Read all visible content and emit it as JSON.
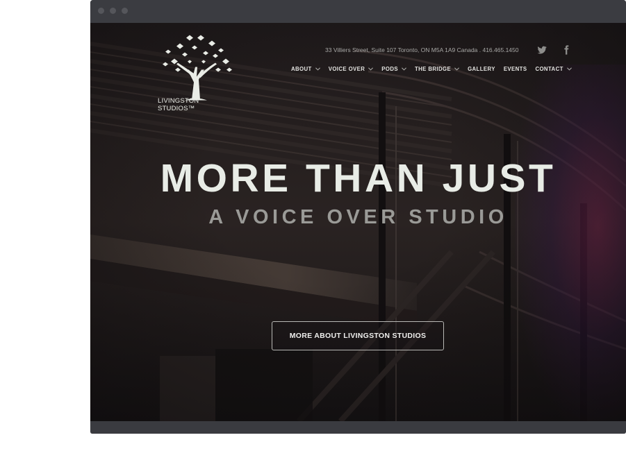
{
  "header": {
    "logo_text": "LIVINGSTON STUDIOS™",
    "address": "33 Villiers Street, Suite 107 Toronto, ON M5A 1A9 Canada  .  416.465.1450",
    "social": [
      {
        "name": "twitter-icon"
      },
      {
        "name": "facebook-icon"
      }
    ]
  },
  "nav": {
    "items": [
      {
        "label": "ABOUT",
        "dropdown": true
      },
      {
        "label": "VOICE OVER",
        "dropdown": true
      },
      {
        "label": "PODS",
        "dropdown": true
      },
      {
        "label": "THE BRIDGE",
        "dropdown": true
      },
      {
        "label": "GALLERY",
        "dropdown": false
      },
      {
        "label": "EVENTS",
        "dropdown": false
      },
      {
        "label": "CONTACT",
        "dropdown": true
      }
    ]
  },
  "hero": {
    "title": "MORE THAN JUST",
    "subtitle": "A VOICE OVER STUDIO",
    "cta_label": "MORE ABOUT LIVINGSTON STUDIOS"
  },
  "colors": {
    "text_light": "#e8ece6",
    "subtitle_gray": "#9a9a97",
    "background_dark": "#191517"
  }
}
